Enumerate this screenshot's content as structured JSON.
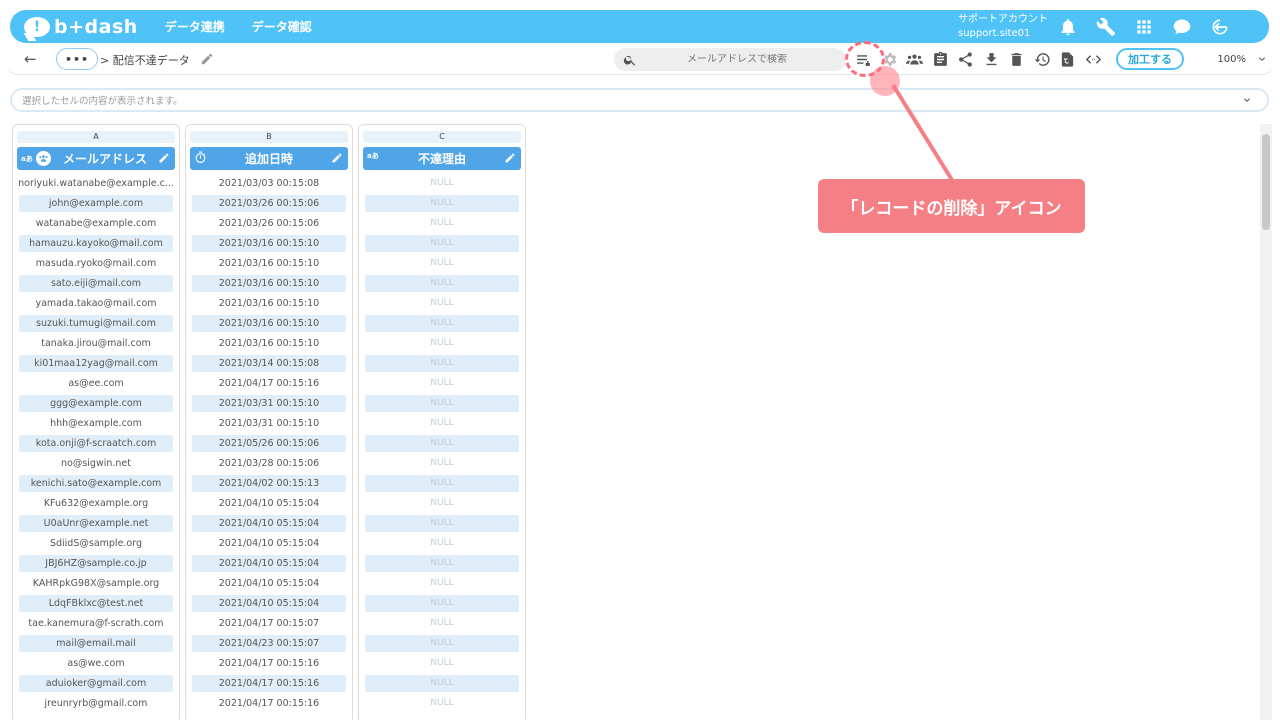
{
  "app": {
    "logo_text": "b+dash",
    "logo_mark": "!",
    "nav": [
      "データ連携",
      "データ確認"
    ],
    "account_name": "サポートアカウント",
    "account_id": "support.site01"
  },
  "toolbar": {
    "dots_label": "•••",
    "breadcrumb": "> 配信不達データ",
    "search_placeholder": "メールアドレスで検索",
    "process_label": "加工する",
    "zoom": "100%"
  },
  "cellbar": {
    "placeholder": "選択したセルの内容が表示されます。"
  },
  "columns": [
    {
      "letter": "A",
      "header": "メールアドレス",
      "type_badge": "aあ"
    },
    {
      "letter": "B",
      "header": "追加日時"
    },
    {
      "letter": "C",
      "header": "不達理由",
      "type_badge": "aあ"
    }
  ],
  "rows": [
    [
      "noriyuki.watanabe@example.c...",
      "2021/03/03 00:15:08",
      "NULL"
    ],
    [
      "john@example.com",
      "2021/03/26 00:15:06",
      "NULL"
    ],
    [
      "watanabe@example.com",
      "2021/03/26 00:15:06",
      "NULL"
    ],
    [
      "hamauzu.kayoko@mail.com",
      "2021/03/16 00:15:10",
      "NULL"
    ],
    [
      "masuda.ryoko@mail.com",
      "2021/03/16 00:15:10",
      "NULL"
    ],
    [
      "sato.eiji@mail.com",
      "2021/03/16 00:15:10",
      "NULL"
    ],
    [
      "yamada.takao@mail.com",
      "2021/03/16 00:15:10",
      "NULL"
    ],
    [
      "suzuki.tumugi@mail.com",
      "2021/03/16 00:15:10",
      "NULL"
    ],
    [
      "tanaka.jirou@mail.com",
      "2021/03/16 00:15:10",
      "NULL"
    ],
    [
      "ki01maa12yag@mail.com",
      "2021/03/14 00:15:08",
      "NULL"
    ],
    [
      "as@ee.com",
      "2021/04/17 00:15:16",
      "NULL"
    ],
    [
      "ggg@example.com",
      "2021/03/31 00:15:10",
      "NULL"
    ],
    [
      "hhh@example.com",
      "2021/03/31 00:15:10",
      "NULL"
    ],
    [
      "kota.onji@f-scraatch.com",
      "2021/05/26 00:15:06",
      "NULL"
    ],
    [
      "no@sigwin.net",
      "2021/03/28 00:15:06",
      "NULL"
    ],
    [
      "kenichi.sato@example.com",
      "2021/04/02 00:15:13",
      "NULL"
    ],
    [
      "KFu632@example.org",
      "2021/04/10 05:15:04",
      "NULL"
    ],
    [
      "U0aUnr@example.net",
      "2021/04/10 05:15:04",
      "NULL"
    ],
    [
      "SdiidS@sample.org",
      "2021/04/10 05:15:04",
      "NULL"
    ],
    [
      "JBJ6HZ@sample.co.jp",
      "2021/04/10 05:15:04",
      "NULL"
    ],
    [
      "KAHRpkG98X@sample.org",
      "2021/04/10 05:15:04",
      "NULL"
    ],
    [
      "LdqFBklxc@test.net",
      "2021/04/10 05:15:04",
      "NULL"
    ],
    [
      "tae.kanemura@f-scrath.com",
      "2021/04/17 00:15:07",
      "NULL"
    ],
    [
      "mail@email.mail",
      "2021/04/23 00:15:07",
      "NULL"
    ],
    [
      "as@we.com",
      "2021/04/17 00:15:16",
      "NULL"
    ],
    [
      "aduioker@gmail.com",
      "2021/04/17 00:15:16",
      "NULL"
    ],
    [
      "jreunryrb@gmail.com",
      "2021/04/17 00:15:16",
      "NULL"
    ]
  ],
  "annotation": {
    "callout_text": "「レコードの削除」アイコン",
    "color": "#f47f84"
  },
  "colors": {
    "brand": "#4fc3f7",
    "header": "#4fa5e8",
    "alt_row": "#e0eef9"
  }
}
